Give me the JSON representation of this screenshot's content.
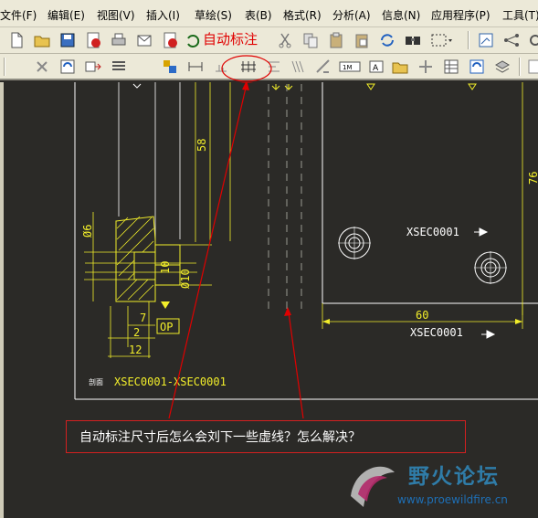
{
  "menu": {
    "items": [
      "文件(F)",
      "编辑(E)",
      "视图(V)",
      "插入(I)",
      "草绘(S)",
      "表(B)",
      "格式(R)",
      "分析(A)",
      "信息(N)",
      "应用程序(P)",
      "工具(T)"
    ]
  },
  "annotation": {
    "label": "自动标注",
    "question": "自动标注尺寸后怎么会刘下一些虚线？怎么解决？"
  },
  "drawing": {
    "dim_58": "58",
    "dim_76": "76",
    "dim_phi6": "Ø6",
    "dim_phi10": "Ø10",
    "dim_10": "10",
    "dim_7": "7",
    "dim_2": "2",
    "dim_12": "12",
    "dim_op": "OP",
    "dim_60": "60",
    "section_label_prefix": "剖面",
    "section_label": "XSEC0001-XSEC0001",
    "xsec_top": "XSEC0001",
    "xsec_bottom": "XSEC0001"
  },
  "watermark": {
    "title": "野火论坛",
    "url": "www.proewildfire.cn"
  },
  "colors": {
    "background": "#2b2a27",
    "cad_yellow": "#f2ee2a",
    "cad_white": "#ffffff",
    "annotation_red": "#e00000",
    "toolbar_bg": "#ece9d8"
  }
}
